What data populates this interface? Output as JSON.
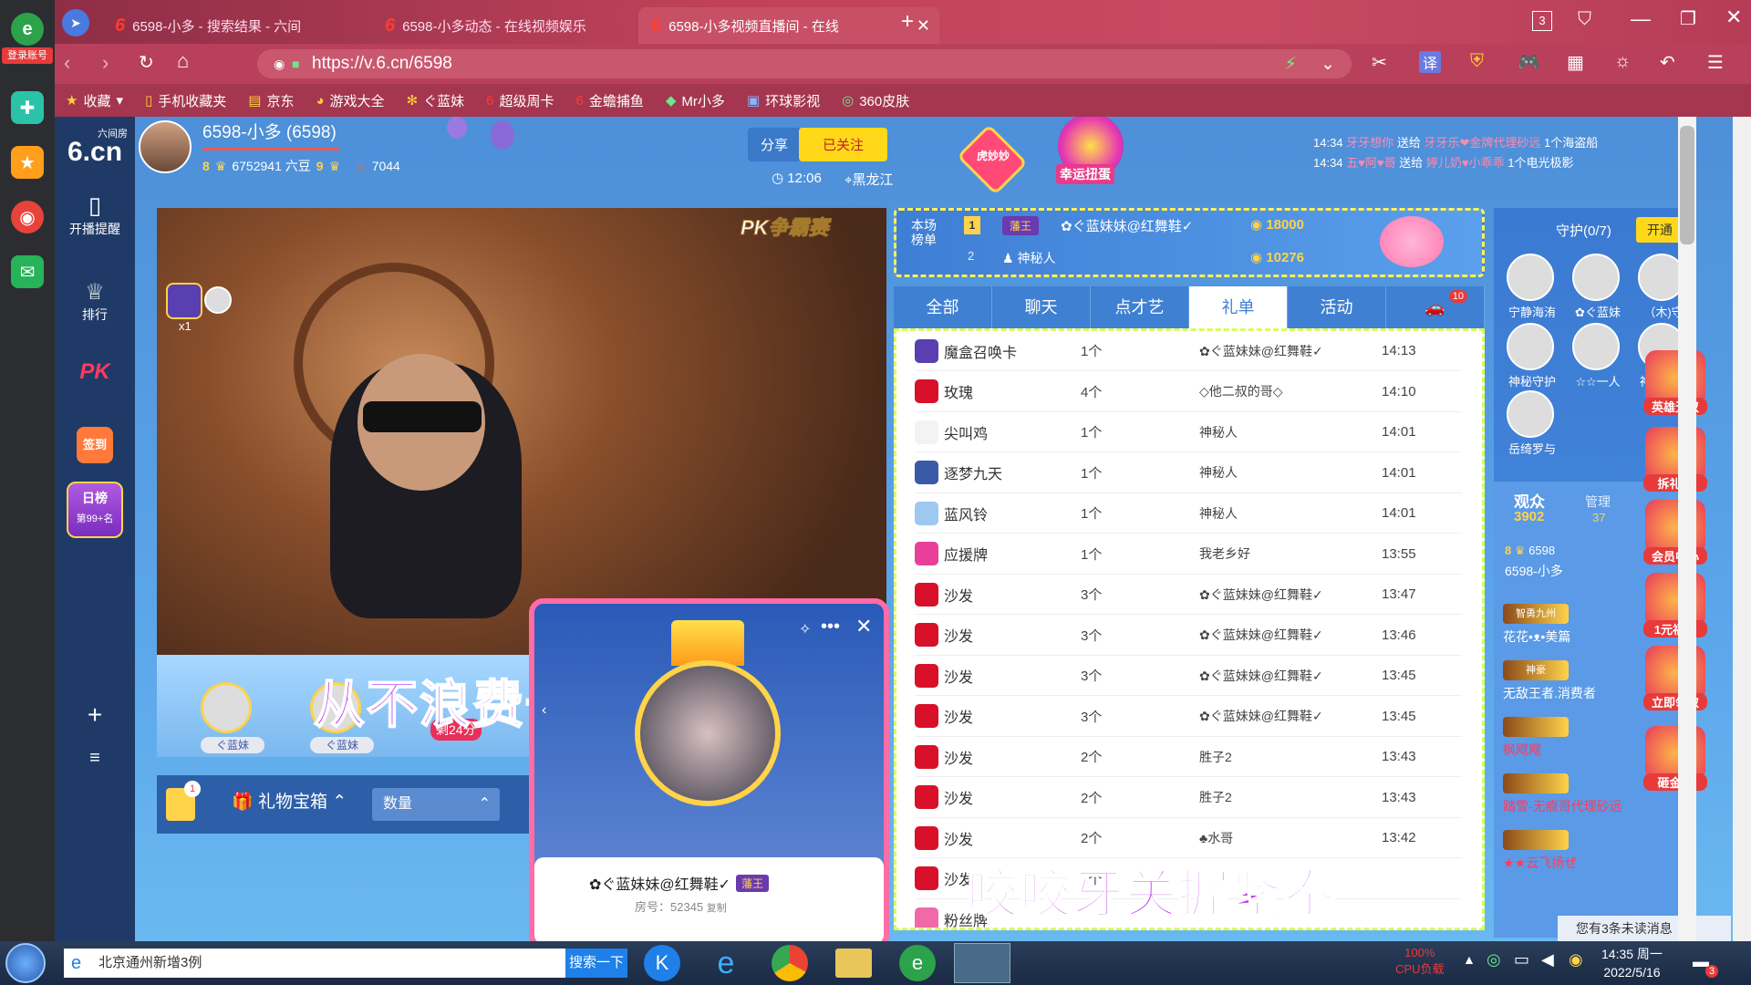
{
  "browser": {
    "login_label": "登录账号",
    "tabs": [
      {
        "label": "6598-小多 - 搜索结果 - 六间"
      },
      {
        "label": "6598-小多动态 - 在线视频娱乐"
      },
      {
        "label": "6598-小多视频直播间 - 在线"
      }
    ],
    "tab_count": "3",
    "url": "https://v.6.cn/6598",
    "bookmarks": [
      "收藏",
      "手机收藏夹",
      "京东",
      "游戏大全",
      "ぐ蓝妹",
      "超级周卡",
      "金蟾捕鱼",
      "Mr小多",
      "环球影视",
      "360皮肤"
    ]
  },
  "site": {
    "logo_top": "六间房",
    "logo": "6.cn",
    "nav": [
      {
        "label": "开播提醒"
      },
      {
        "label": "排行"
      },
      {
        "label": "PK"
      },
      {
        "label": "签到"
      },
      {
        "label": "日榜"
      }
    ],
    "daily_rank": "第99+名"
  },
  "streamer": {
    "name": "6598-小多 (6598)",
    "level": "8",
    "beans": "6752941 六豆",
    "fans_level": "9",
    "heat": "7044",
    "share_label": "分享",
    "follow_label": "已关注",
    "time": "12:06",
    "location": "黑龙江",
    "lucky_label": "幸运扭蛋",
    "badge_label": "虎妙妙"
  },
  "video": {
    "pk_label": "PK争霸赛",
    "subtitle_main": "从不浪费一秒时间",
    "subtitle_bottom": "咬咬牙关握紧拳",
    "bottom_users": [
      "ぐ蓝妹",
      "ぐ蓝妹"
    ],
    "multiplier": "x1",
    "countdown": "剩24分",
    "toolbar": {
      "badge_count": "1",
      "treasure_label": "礼物宝箱",
      "qty_label": "数量"
    }
  },
  "popup": {
    "user": "✿ぐ蓝妹妹@红舞鞋✓",
    "badge": "藩王",
    "room_label": "房号：52345",
    "copy_label": "复制"
  },
  "ticker": [
    {
      "time": "14:34",
      "from": "牙牙想你",
      "verb": "送给",
      "to": "牙牙乐❤金牌代理砂远",
      "gift": "1个海盗船"
    },
    {
      "time": "14:34",
      "from": "五♥阿♥哥",
      "verb": "送给",
      "to": "婷儿奶♥小乖乖",
      "gift": "1个电光极影"
    }
  ],
  "rank": {
    "title": "本场榜单",
    "rows": [
      {
        "pos": "1",
        "badge": "藩王",
        "name": "✿ぐ蓝妹妹@红舞鞋✓",
        "score": "18000"
      },
      {
        "pos": "2",
        "badge": "",
        "name": "神秘人",
        "score": "10276"
      }
    ]
  },
  "tabs": [
    {
      "label": "全部"
    },
    {
      "label": "聊天"
    },
    {
      "label": "点才艺"
    },
    {
      "label": "礼单"
    },
    {
      "label": "活动"
    },
    {
      "label": "10"
    }
  ],
  "gifts": [
    {
      "name": "魔盒召唤卡",
      "qty": "1个",
      "user": "✿ぐ蓝妹妹@红舞鞋✓",
      "time": "14:13",
      "color": "#5a3fb0"
    },
    {
      "name": "玫瑰",
      "qty": "4个",
      "user": "◇他二叔的哥◇",
      "time": "14:10",
      "color": "#d8102a"
    },
    {
      "name": "尖叫鸡",
      "qty": "1个",
      "user": "神秘人",
      "time": "14:01",
      "color": "#f3f3f3"
    },
    {
      "name": "逐梦九天",
      "qty": "1个",
      "user": "神秘人",
      "time": "14:01",
      "color": "#3a5aa8"
    },
    {
      "name": "蓝风铃",
      "qty": "1个",
      "user": "神秘人",
      "time": "14:01",
      "color": "#9ec8f0"
    },
    {
      "name": "应援牌",
      "qty": "1个",
      "user": "我老乡好",
      "time": "13:55",
      "color": "#e8409a"
    },
    {
      "name": "沙发",
      "qty": "3个",
      "user": "✿ぐ蓝妹妹@红舞鞋✓",
      "time": "13:47",
      "color": "#d8102a"
    },
    {
      "name": "沙发",
      "qty": "3个",
      "user": "✿ぐ蓝妹妹@红舞鞋✓",
      "time": "13:46",
      "color": "#d8102a"
    },
    {
      "name": "沙发",
      "qty": "3个",
      "user": "✿ぐ蓝妹妹@红舞鞋✓",
      "time": "13:45",
      "color": "#d8102a"
    },
    {
      "name": "沙发",
      "qty": "3个",
      "user": "✿ぐ蓝妹妹@红舞鞋✓",
      "time": "13:45",
      "color": "#d8102a"
    },
    {
      "name": "沙发",
      "qty": "2个",
      "user": "胜子2",
      "time": "13:43",
      "color": "#d8102a"
    },
    {
      "name": "沙发",
      "qty": "2个",
      "user": "胜子2",
      "time": "13:43",
      "color": "#d8102a"
    },
    {
      "name": "沙发",
      "qty": "2个",
      "user": "♣水哥",
      "time": "13:42",
      "color": "#d8102a"
    },
    {
      "name": "沙发",
      "qty": "2个",
      "user": "",
      "time": "",
      "color": "#d8102a"
    },
    {
      "name": "粉丝牌",
      "qty": "",
      "user": "",
      "time": "",
      "color": "#f06aa8"
    }
  ],
  "guard": {
    "title": "守护(0/7)",
    "open_label": "开通",
    "members": [
      "宁静海洧",
      "✿ぐ蓝妹",
      "（木)守",
      "神秘守护",
      "☆☆一人",
      "神秘守护",
      "岳绮罗与"
    ],
    "audience_label": "观众",
    "audience_count": "3902",
    "admin_label": "管理",
    "admin_count": "37",
    "host_level": "8",
    "host_id": "6598",
    "host_name": "6598-小多",
    "viewers": [
      {
        "badge": "智勇九州",
        "name": "花花•ᴥ•美篇"
      },
      {
        "badge": "神豪",
        "name": "无敌王者.消费者"
      },
      {
        "badge": "",
        "name": "枫飕飕"
      },
      {
        "badge": "",
        "name": "踏雪-无痕哥代理砂远"
      },
      {
        "badge": "",
        "name": "★★云飞扬ぜ"
      }
    ],
    "unread": "您有3条未读消息"
  },
  "promos": [
    "英雄无双",
    "拆礼包",
    "会员中心",
    "1元福利",
    "立即领取",
    "砸金蛋"
  ],
  "taskbar": {
    "search_text": "北京通州新增3例",
    "search_btn": "搜索一下",
    "cpu_pct": "100%",
    "cpu_label": "CPU负载",
    "time": "14:35 周一",
    "date": "2022/5/16",
    "notif_count": "3"
  }
}
